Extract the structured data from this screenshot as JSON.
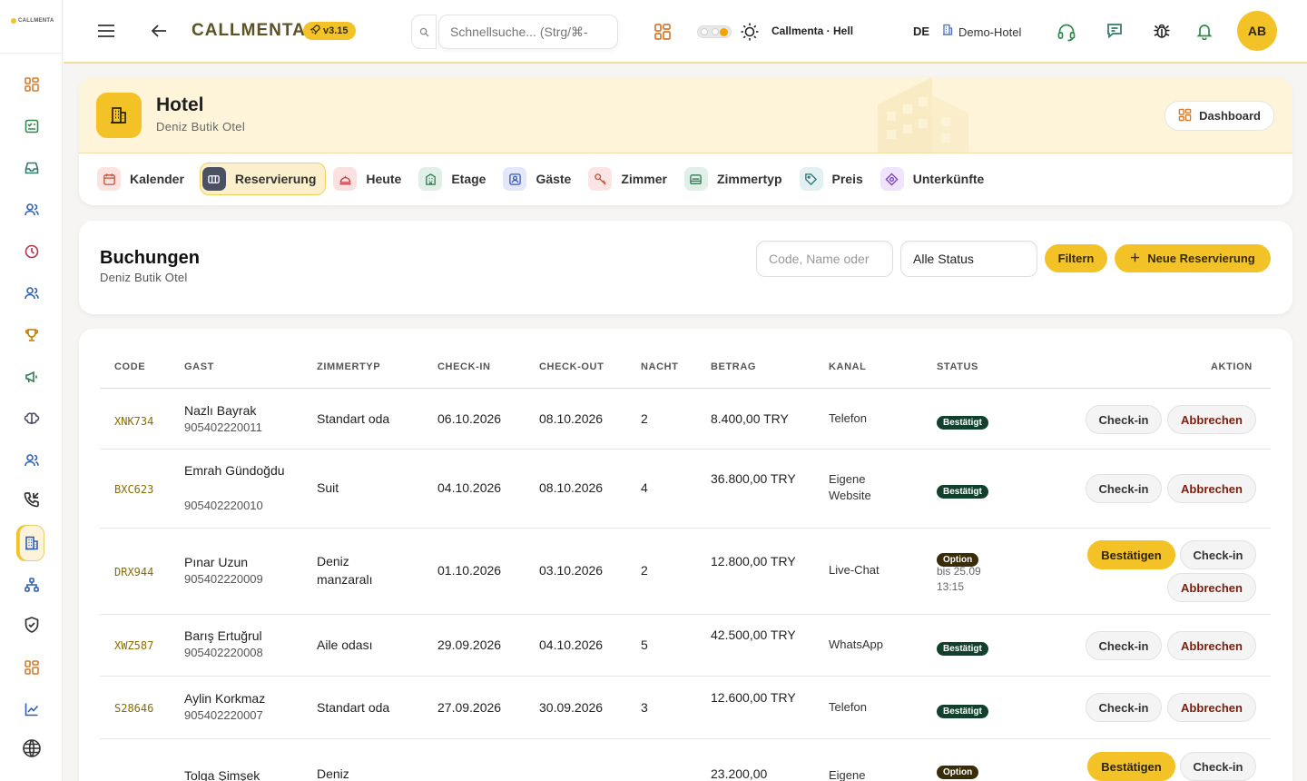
{
  "sidebar": {
    "logo_text": "CALLMENTA",
    "items": [
      {
        "icon": "dashboard-grid-icon"
      },
      {
        "icon": "checklist-icon"
      },
      {
        "icon": "inbox-icon"
      },
      {
        "icon": "users-icon"
      },
      {
        "icon": "clock-icon"
      },
      {
        "icon": "team-icon"
      },
      {
        "icon": "trophy-icon"
      },
      {
        "icon": "megaphone-icon"
      },
      {
        "icon": "brain-icon"
      },
      {
        "icon": "contacts-icon"
      },
      {
        "icon": "phone-incoming-icon"
      },
      {
        "icon": "hotel-icon",
        "active": true
      },
      {
        "icon": "hierarchy-icon"
      },
      {
        "icon": "shield-check-icon"
      },
      {
        "icon": "apps-grid-icon"
      },
      {
        "icon": "chart-line-icon"
      },
      {
        "icon": "globe-icon"
      }
    ]
  },
  "topbar": {
    "brand": "CALLMENTA",
    "version": "v3.15",
    "search_placeholder": "Schnellsuche... (Strg/⌘-",
    "theme_label": "Callmenta · Hell",
    "language": "DE",
    "hotel_label": "Demo-Hotel",
    "avatar_initials": "AB"
  },
  "hotel": {
    "title": "Hotel",
    "subtitle": "Deniz Butik Otel",
    "dashboard_button": "Dashboard",
    "tabs": [
      {
        "label": "Kalender",
        "icon": "calendar-icon",
        "color": "#fbe4e0",
        "fg": "#c0513c"
      },
      {
        "label": "Reservierung",
        "icon": "reservation-icon",
        "color": "#4a5163",
        "fg": "#ffffff",
        "active": true
      },
      {
        "label": "Heute",
        "icon": "bell-desk-icon",
        "color": "#fbe0e0",
        "fg": "#b8424d"
      },
      {
        "label": "Etage",
        "icon": "building-icon",
        "color": "#e0f0e8",
        "fg": "#2f7a55"
      },
      {
        "label": "Gäste",
        "icon": "guest-icon",
        "color": "#e2e8fa",
        "fg": "#3b5bb5"
      },
      {
        "label": "Zimmer",
        "icon": "key-icon",
        "color": "#fbe4e4",
        "fg": "#c0513c"
      },
      {
        "label": "Zimmertyp",
        "icon": "bed-icon",
        "color": "#e0f0e8",
        "fg": "#2f7a55"
      },
      {
        "label": "Preis",
        "icon": "tag-icon",
        "color": "#e2f0f2",
        "fg": "#2f6f7a"
      },
      {
        "label": "Unterkünfte",
        "icon": "diamond-icon",
        "color": "#efe4fb",
        "fg": "#7a3fc0"
      }
    ]
  },
  "bookings": {
    "title": "Buchungen",
    "subtitle": "Deniz Butik Otel",
    "search_placeholder": "Code, Name oder",
    "status_select": "Alle Status",
    "filter_button": "Filtern",
    "new_button": "Neue Reservierung"
  },
  "table": {
    "columns": [
      "CODE",
      "GAST",
      "ZIMMERTYP",
      "CHECK-IN",
      "CHECK-OUT",
      "NACHT",
      "BETRAG",
      "KANAL",
      "STATUS",
      "AKTION"
    ],
    "rows": [
      {
        "code": "XNK734",
        "guest": "Nazlı Bayrak",
        "phone": "905402220011",
        "room": "Standart oda",
        "checkin": "06.10.2026",
        "checkout": "08.10.2026",
        "nights": "2",
        "amount": "8.400,00 TRY",
        "channel": "Telefon",
        "status": "Bestätigt",
        "status_kind": "confirmed",
        "until": "",
        "actions": [
          "Check-in",
          "Abbrechen"
        ]
      },
      {
        "code": "BXC623",
        "guest": "Emrah Gündoğdu",
        "phone": "905402220010",
        "room": "Suit",
        "checkin": "04.10.2026",
        "checkout": "08.10.2026",
        "nights": "4",
        "amount": "36.800,00 TRY",
        "channel": "Eigene Website",
        "status": "Bestätigt",
        "status_kind": "confirmed",
        "until": "",
        "actions": [
          "Check-in",
          "Abbrechen"
        ]
      },
      {
        "code": "DRX944",
        "guest": "Pınar Uzun",
        "phone": "905402220009",
        "room": "Deniz manzaralı",
        "checkin": "01.10.2026",
        "checkout": "03.10.2026",
        "nights": "2",
        "amount": "12.800,00 TRY",
        "channel": "Live-Chat",
        "status": "Option",
        "status_kind": "option",
        "until": "bis 25.09 13:15",
        "actions": [
          "Bestätigen",
          "Check-in",
          "Abbrechen"
        ]
      },
      {
        "code": "XWZ587",
        "guest": "Barış Ertuğrul",
        "phone": "905402220008",
        "room": "Aile odası",
        "checkin": "29.09.2026",
        "checkout": "04.10.2026",
        "nights": "5",
        "amount": "42.500,00 TRY",
        "channel": "WhatsApp",
        "status": "Bestätigt",
        "status_kind": "confirmed",
        "until": "",
        "actions": [
          "Check-in",
          "Abbrechen"
        ]
      },
      {
        "code": "S28646",
        "guest": "Aylin Korkmaz",
        "phone": "905402220007",
        "room": "Standart oda",
        "checkin": "27.09.2026",
        "checkout": "30.09.2026",
        "nights": "3",
        "amount": "12.600,00 TRY",
        "channel": "Telefon",
        "status": "Bestätigt",
        "status_kind": "confirmed",
        "until": "",
        "actions": [
          "Check-in",
          "Abbrechen"
        ]
      },
      {
        "code": "",
        "guest": "Tolga Şimşek",
        "phone": "",
        "room": "Deniz",
        "checkin": "",
        "checkout": "",
        "nights": "",
        "amount": "23.200,00",
        "channel": "Eigene",
        "status": "Option",
        "status_kind": "option",
        "until": "",
        "actions": [
          "Bestätigen",
          "Check-in"
        ]
      }
    ]
  },
  "colors": {
    "accent": "#f3c227",
    "confirmed_badge": "#11402d",
    "option_badge": "#3a2c06",
    "cancel_text": "#7a1f0f"
  }
}
